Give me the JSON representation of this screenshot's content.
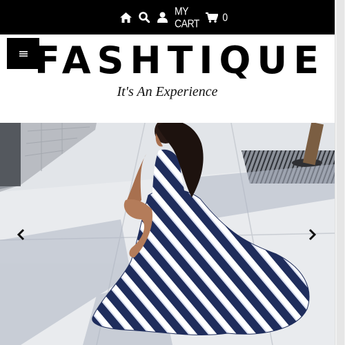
{
  "header": {
    "cart_label": "MY CART",
    "cart_count": "0",
    "icons": [
      "home-icon",
      "search-icon",
      "user-icon",
      "cart-icon"
    ]
  },
  "brand": {
    "logo": "FASHTIQUE",
    "tagline": "It's An Experience"
  },
  "slider": {
    "prev_icon": "chevron-left-icon",
    "next_icon": "chevron-right-icon"
  },
  "menu": {
    "icon": "hamburger-menu-icon"
  },
  "colors": {
    "topbar": "#000000",
    "dress_stripe": "#1f2d5c"
  }
}
